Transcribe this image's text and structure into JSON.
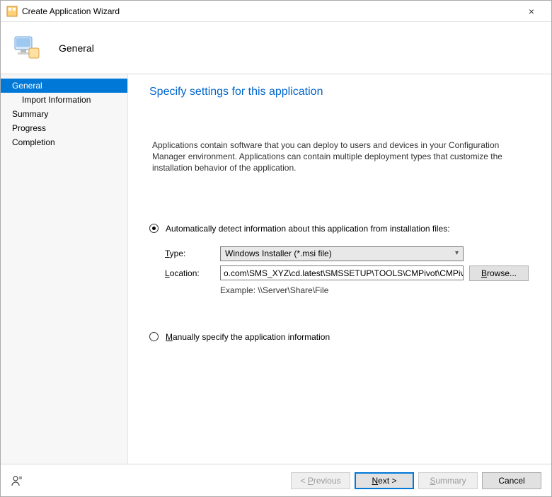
{
  "window": {
    "title": "Create Application Wizard"
  },
  "header": {
    "step_title": "General"
  },
  "sidebar": {
    "items": [
      {
        "label": "General",
        "selected": true,
        "sub": false
      },
      {
        "label": "Import Information",
        "selected": false,
        "sub": true
      },
      {
        "label": "Summary",
        "selected": false,
        "sub": false
      },
      {
        "label": "Progress",
        "selected": false,
        "sub": false
      },
      {
        "label": "Completion",
        "selected": false,
        "sub": false
      }
    ]
  },
  "page": {
    "title": "Specify settings for this application",
    "intro": "Applications contain software that you can deploy to users and devices in your Configuration Manager environment. Applications can contain multiple deployment types that customize the installation behavior of the application.",
    "radio_auto_label": "Automatically detect information about this application from installation files:",
    "type_label": "Type:",
    "type_value": "Windows Installer (*.msi file)",
    "location_label": "Location:",
    "location_value": "o.com\\SMS_XYZ\\cd.latest\\SMSSETUP\\TOOLS\\CMPivot\\CMPivot.msi",
    "browse_label": "Browse...",
    "example_label": "Example: \\\\Server\\Share\\File",
    "radio_manual_label": "Manually specify the application information"
  },
  "footer": {
    "previous": "< Previous",
    "next": "Next >",
    "summary": "Summary",
    "cancel": "Cancel"
  }
}
